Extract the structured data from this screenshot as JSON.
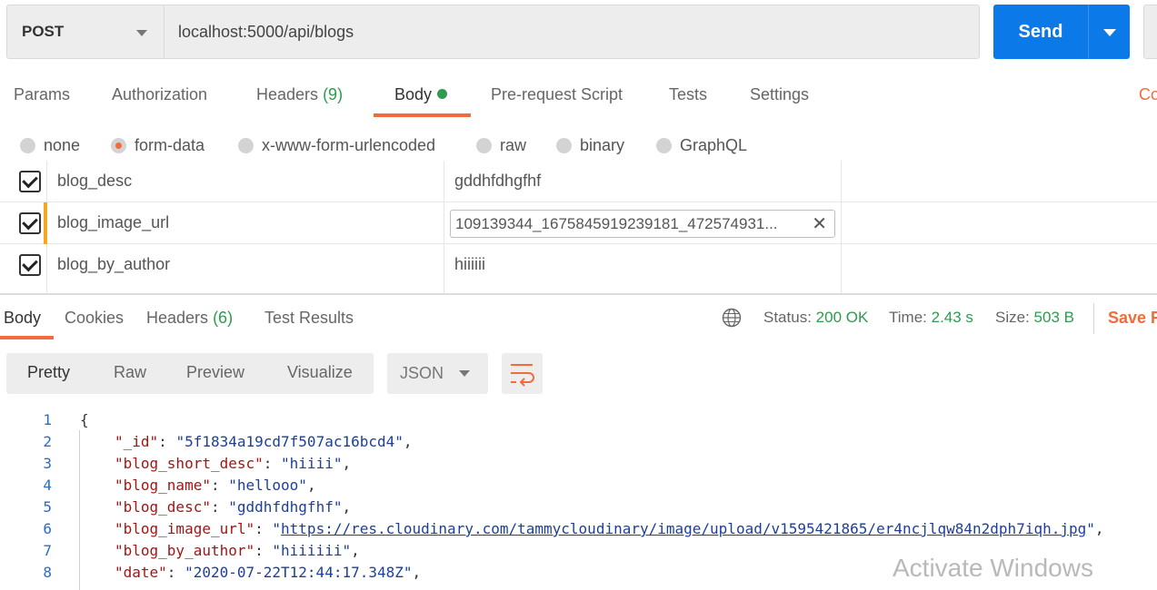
{
  "request": {
    "method": "POST",
    "url": "localhost:5000/api/blogs",
    "send_label": "Send",
    "cookies_label": "Cookies"
  },
  "request_tabs": {
    "params": "Params",
    "authorization": "Authorization",
    "headers": "Headers",
    "headers_count": "(9)",
    "body": "Body",
    "prerequest": "Pre-request Script",
    "tests": "Tests",
    "settings": "Settings"
  },
  "body_types": {
    "none": "none",
    "form_data": "form-data",
    "urlencoded": "x-www-form-urlencoded",
    "raw": "raw",
    "binary": "binary",
    "graphql": "GraphQL",
    "selected": "form-data"
  },
  "form_rows": [
    {
      "key": "blog_desc",
      "value": "gddhfdhgfhf"
    },
    {
      "key": "blog_image_url",
      "value": "109139344_1675845919239181_472574931..."
    },
    {
      "key": "blog_by_author",
      "value": "hiiiiii"
    }
  ],
  "response_tabs": {
    "body": "Body",
    "cookies": "Cookies",
    "headers": "Headers",
    "headers_count": "(6)",
    "test_results": "Test Results"
  },
  "response_meta": {
    "status_label": "Status:",
    "status_value": "200 OK",
    "time_label": "Time:",
    "time_value": "2.43 s",
    "size_label": "Size:",
    "size_value": "503 B",
    "save_label": "Save R"
  },
  "format": {
    "pretty": "Pretty",
    "raw": "Raw",
    "preview": "Preview",
    "visualize": "Visualize",
    "language": "JSON"
  },
  "code": {
    "line_numbers": [
      "1",
      "2",
      "3",
      "4",
      "5",
      "6",
      "7",
      "8"
    ],
    "open_brace": "{",
    "lines": [
      {
        "key": "\"_id\"",
        "value": "\"5f1834a19cd7f507ac16bcd4\""
      },
      {
        "key": "\"blog_short_desc\"",
        "value": "\"hiiii\""
      },
      {
        "key": "\"blog_name\"",
        "value": "\"hellooo\""
      },
      {
        "key": "\"blog_desc\"",
        "value": "\"gddhfdhgfhf\""
      },
      {
        "key": "\"blog_image_url\"",
        "value": "https://res.cloudinary.com/tammycloudinary/image/upload/v1595421865/er4ncjlqw84n2dph7iqh.jpg"
      },
      {
        "key": "\"blog_by_author\"",
        "value": "\"hiiiiii\""
      },
      {
        "key": "\"date\"",
        "value": "\"2020-07-22T12:44:17.348Z\""
      }
    ]
  },
  "watermark": "Activate Windows",
  "icons": {
    "globe": "globe-icon",
    "wrap": "wrap-lines-icon",
    "clear": "close-icon"
  },
  "colors": {
    "accent": "#f26b3a",
    "send": "#0b79e8",
    "success": "#2e9b4e"
  }
}
